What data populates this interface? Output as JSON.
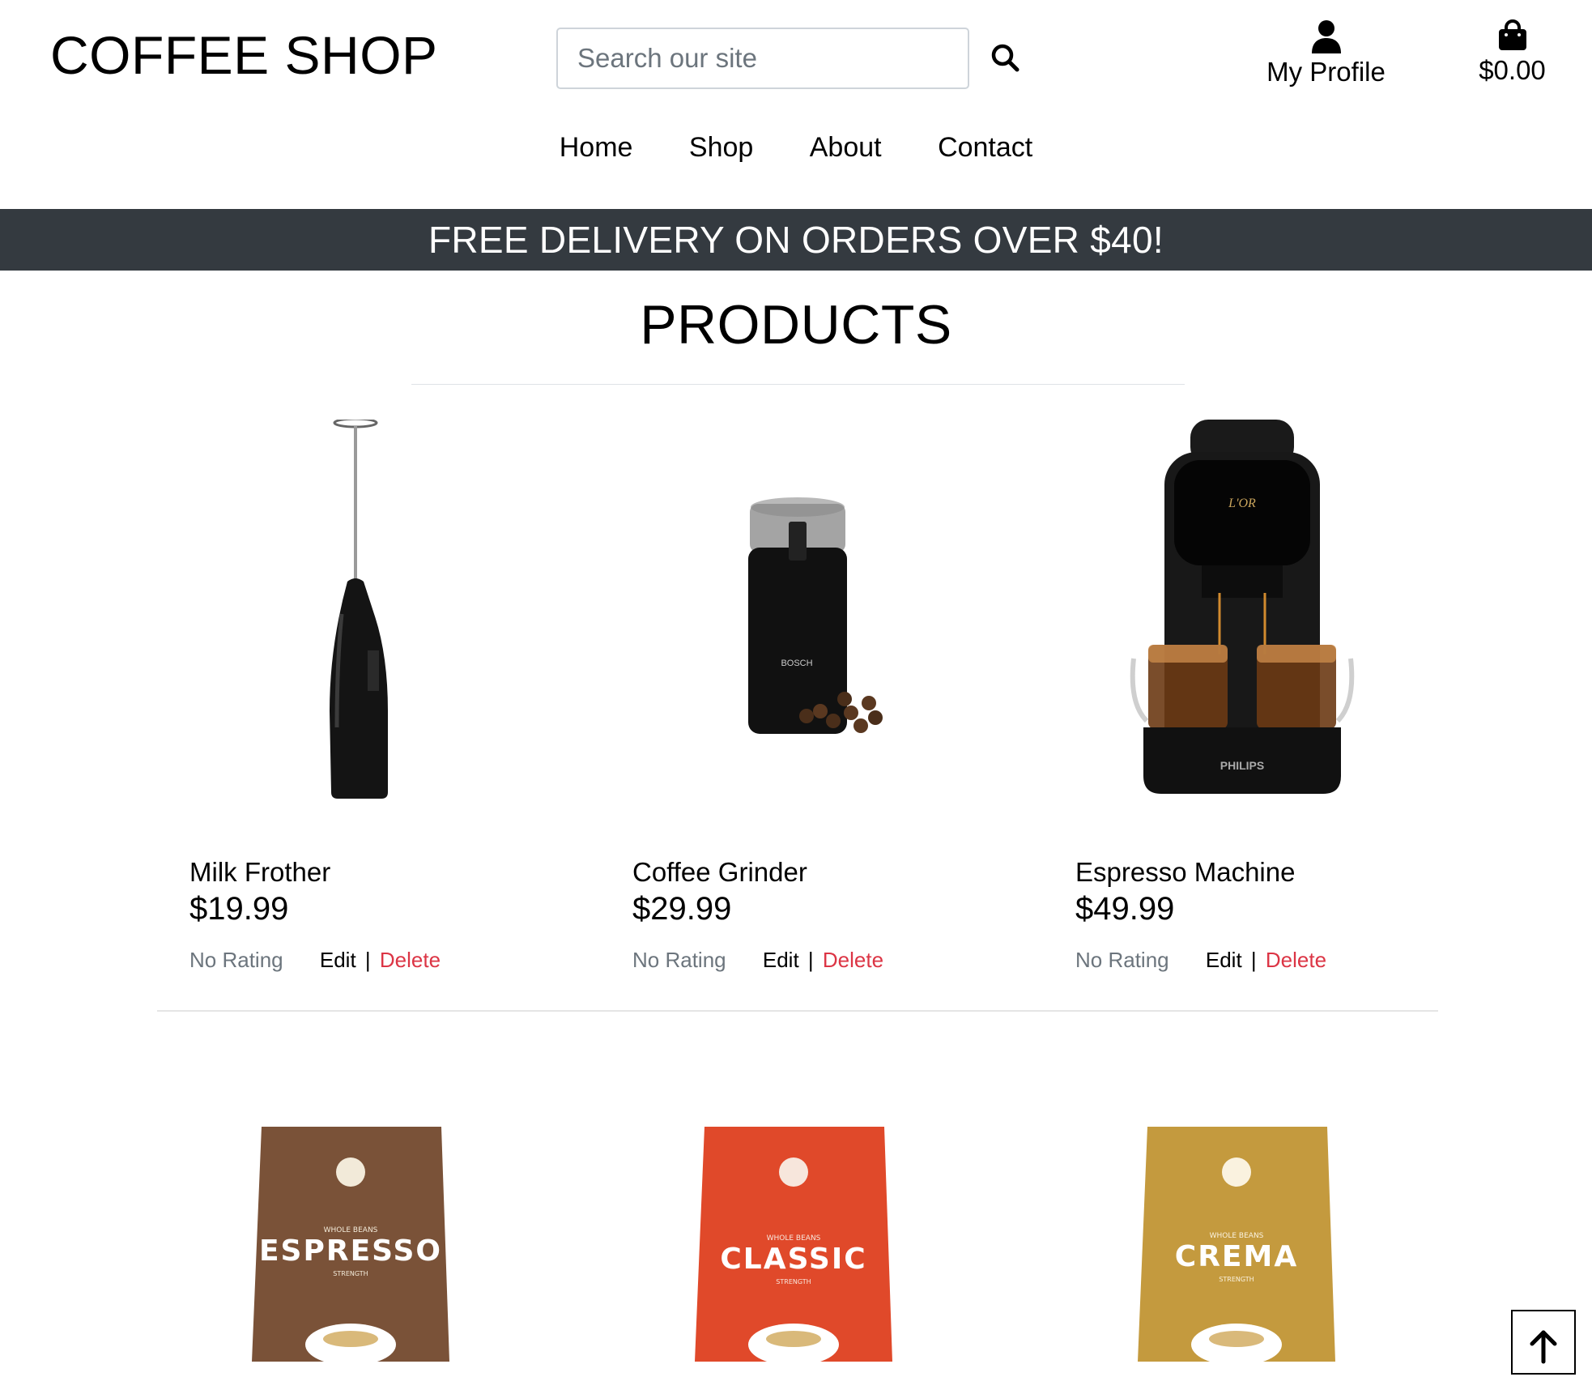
{
  "header": {
    "brand": "COFFEE SHOP",
    "search_placeholder": "Search our site",
    "profile_label": "My Profile",
    "bag_total": "$0.00",
    "icons": [
      "search-icon",
      "user-icon",
      "shopping-bag-icon"
    ]
  },
  "nav": {
    "items": [
      {
        "label": "Home"
      },
      {
        "label": "Shop"
      },
      {
        "label": "About"
      },
      {
        "label": "Contact"
      }
    ]
  },
  "banner": {
    "text": "FREE DELIVERY ON ORDERS OVER $40!"
  },
  "main": {
    "title": "PRODUCTS",
    "products": [
      {
        "name": "Milk Frother",
        "price": "$19.99",
        "rating": "No Rating",
        "edit": "Edit",
        "separator": "|",
        "delete": "Delete"
      },
      {
        "name": "Coffee Grinder",
        "price": "$29.99",
        "rating": "No Rating",
        "edit": "Edit",
        "separator": "|",
        "delete": "Delete"
      },
      {
        "name": "Espresso Machine",
        "price": "$49.99",
        "rating": "No Rating",
        "edit": "Edit",
        "separator": "|",
        "delete": "Delete"
      }
    ],
    "coffee_bags": [
      {
        "name": "ESPRESSO",
        "tagline": "WHOLE BEANS",
        "strength_label": "STRENGTH",
        "color": "#7a5238"
      },
      {
        "name": "CLASSIC",
        "tagline": "WHOLE BEANS",
        "strength_label": "STRENGTH",
        "color": "#e0492a"
      },
      {
        "name": "CREMA",
        "tagline": "WHOLE BEANS",
        "strength_label": "STRENGTH",
        "color": "#c49a3e"
      }
    ],
    "machine_brand": "PHILIPS",
    "machine_logo": "L'OR",
    "grinder_brand": "BOSCH"
  },
  "colors": {
    "banner_bg": "#343a40",
    "delete": "#dc3545",
    "muted": "#6c757d"
  },
  "back_to_top_icon": "arrow-up-icon"
}
